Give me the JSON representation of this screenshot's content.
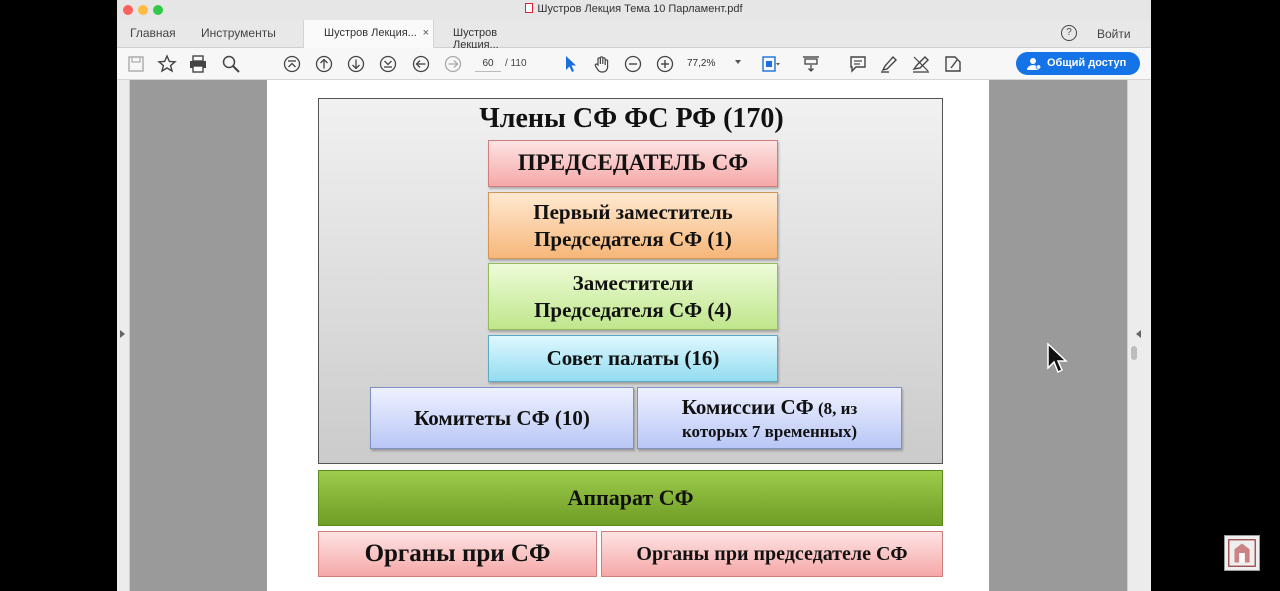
{
  "window": {
    "title": "Шустров Лекция Тема 10 Парламент.pdf"
  },
  "tabs": {
    "home": "Главная",
    "tools": "Инструменты",
    "doc_tab_1": "Шустров Лекция...",
    "doc_tab_2": "Шустров Лекция...",
    "close": "×"
  },
  "header": {
    "help": "?",
    "login": "Войти"
  },
  "toolbar": {
    "page_current": "60",
    "page_total": "/ 110",
    "zoom": "77,2%",
    "share_label": "Общий доступ"
  },
  "slide": {
    "heading": "Члены СФ ФС РФ (170)",
    "chairman": "ПРЕДСЕДАТЕЛЬ СФ",
    "first_deputy_line1": "Первый заместитель",
    "first_deputy_line2": "Председателя СФ (1)",
    "deputies_line1": "Заместители",
    "deputies_line2": "Председателя СФ (4)",
    "council": "Совет палаты (16)",
    "committees": "Комитеты СФ (10)",
    "commissions_main": "Комиссии СФ",
    "commissions_suffix": " (8, из",
    "commissions_line2": "которых 7 временных)",
    "apparatus": "Аппарат СФ",
    "bodies_sf": "Органы при СФ",
    "bodies_chair": "Органы при председателе СФ"
  },
  "colors": {
    "share_button": "#1473e6",
    "apparatus": "#7fae2f",
    "red_box": "#f6a8a8",
    "orange_box": "#f6b77a",
    "green_box": "#bfe68c",
    "cyan_box": "#93dcf0",
    "blue_box": "#b9c7f6"
  },
  "icons": [
    "save-icon",
    "bookmark-star-icon",
    "print-icon",
    "search-zoom-icon",
    "scroll-top-icon",
    "page-up-icon",
    "page-down-icon",
    "scroll-bottom-icon",
    "back-icon",
    "forward-icon",
    "select-arrow-icon",
    "hand-icon",
    "zoom-out-icon",
    "zoom-in-icon",
    "fit-page-icon",
    "scroll-mode-icon",
    "comment-icon",
    "highlight-pen-icon",
    "sign-icon",
    "fill-sign-icon",
    "help-icon",
    "person-icon"
  ]
}
